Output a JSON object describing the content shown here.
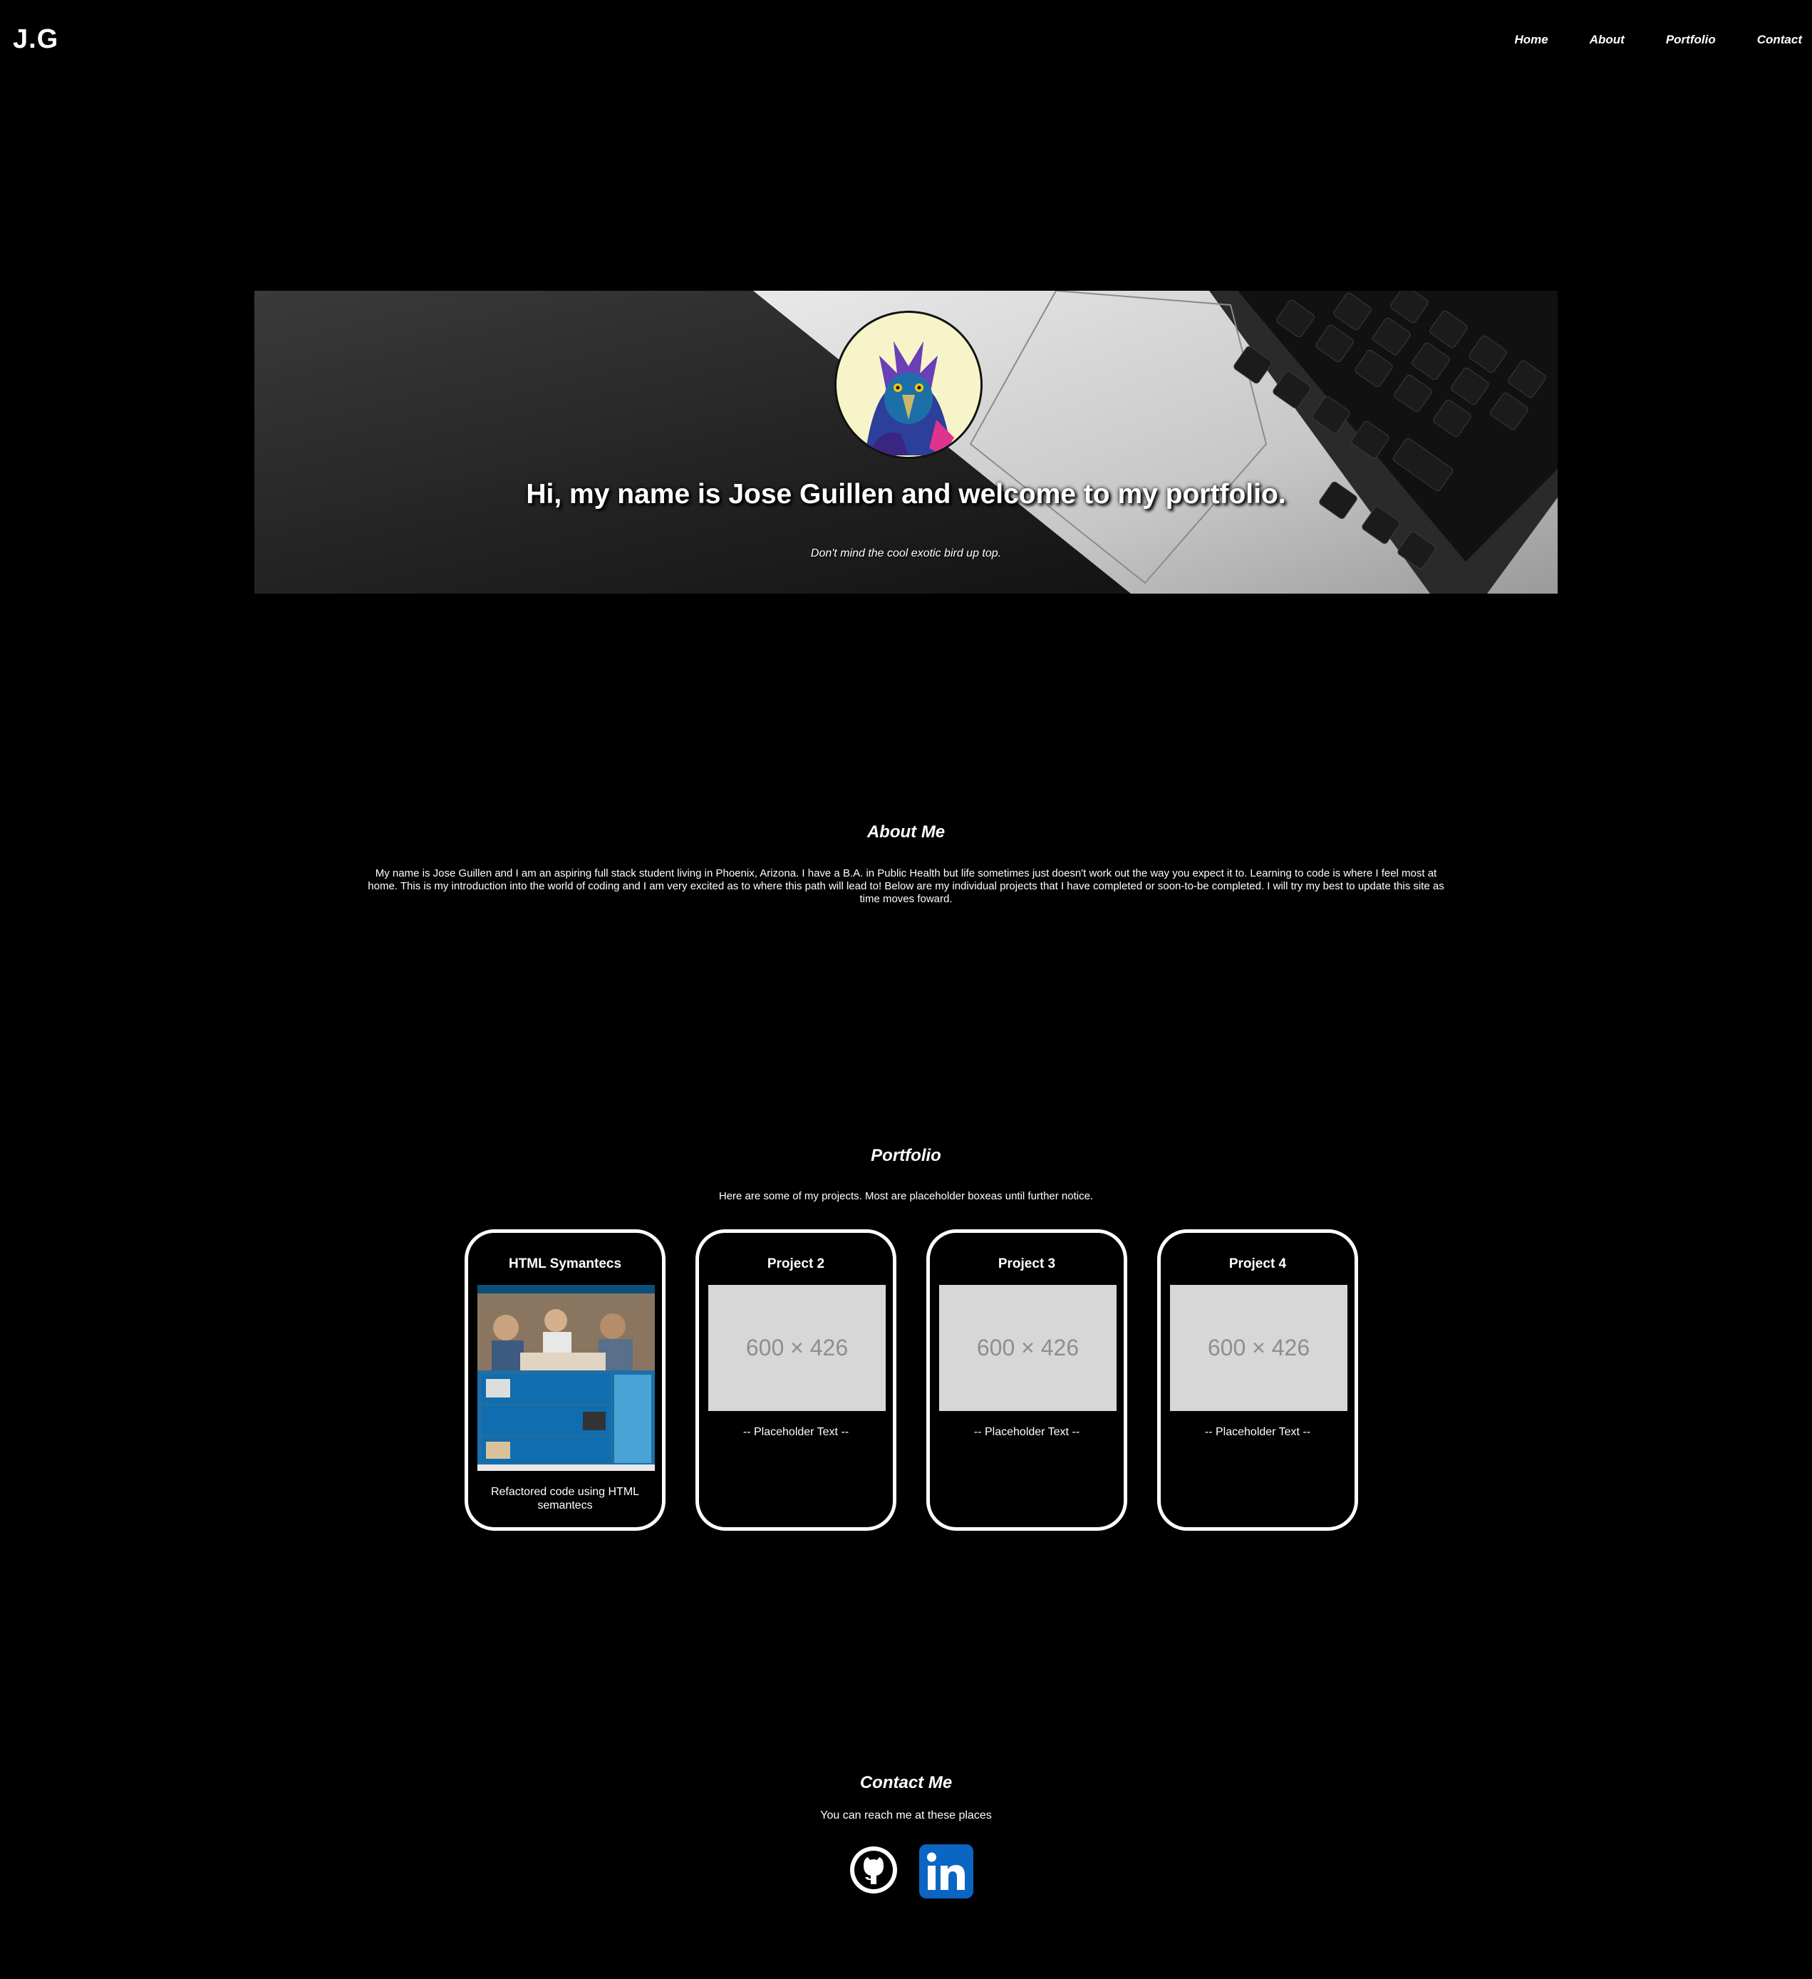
{
  "header": {
    "logo": "J.G",
    "nav": [
      "Home",
      "About",
      "Portfolio",
      "Contact"
    ]
  },
  "hero": {
    "title": "Hi, my name is Jose Guillen and welcome to my portfolio.",
    "subtitle": "Don't mind the cool exotic bird up top."
  },
  "about": {
    "heading": "About Me",
    "text": "My name is Jose Guillen and I am an aspiring full stack student living in Phoenix, Arizona. I have a B.A. in Public Health but life sometimes just doesn't work out the way you expect it to. Learning to code is where I feel most at home. This is my introduction into the world of coding and I am very excited as to where this path will lead to! Below are my individual projects that I have completed or soon-to-be completed. I will try my best to update this site as time moves foward."
  },
  "portfolio": {
    "heading": "Portfolio",
    "intro": "Here are some of my projects. Most are placeholder boxeas until further notice.",
    "projects": [
      {
        "title": "HTML Symantecs",
        "description": "Refactored code using HTML semantecs",
        "image": "screenshot"
      },
      {
        "title": "Project 2",
        "description": "-- Placeholder Text --",
        "image": "600 × 426"
      },
      {
        "title": "Project 3",
        "description": "-- Placeholder Text --",
        "image": "600 × 426"
      },
      {
        "title": "Project 4",
        "description": "-- Placeholder Text --",
        "image": "600 × 426"
      }
    ]
  },
  "contact": {
    "heading": "Contact Me",
    "text": "You can reach me at these places",
    "links": [
      {
        "icon": "github-icon"
      },
      {
        "icon": "linkedin-icon",
        "color": "#0a66c2"
      }
    ]
  },
  "colors": {
    "background": "#000000",
    "text": "#ffffff",
    "placeholder": "#d7d7d7",
    "linkedin": "#0a66c2"
  }
}
